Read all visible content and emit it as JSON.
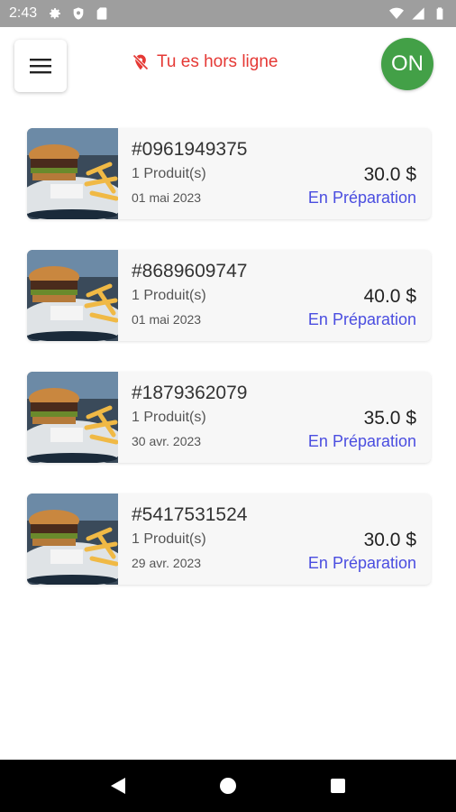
{
  "status_bar": {
    "time": "2:43",
    "icons_left": [
      "gear-icon",
      "shield-icon",
      "sd-card-icon"
    ],
    "icons_right": [
      "wifi-icon",
      "signal-icon",
      "battery-icon"
    ]
  },
  "header": {
    "menu_icon": "hamburger-menu-icon",
    "offline_icon": "location-off-icon",
    "offline_text": "Tu es hors ligne",
    "on_label": "ON",
    "colors": {
      "offline": "#e53935",
      "on_button": "#43a047"
    }
  },
  "orders": [
    {
      "id": "#0961949375",
      "quantity": "1 Produit(s)",
      "date": "01 mai 2023",
      "price": "30.0 $",
      "status": "En Préparation"
    },
    {
      "id": "#8689609747",
      "quantity": "1 Produit(s)",
      "date": "01 mai 2023",
      "price": "40.0 $",
      "status": "En Préparation"
    },
    {
      "id": "#1879362079",
      "quantity": "1 Produit(s)",
      "date": "30 avr. 2023",
      "price": "35.0 $",
      "status": "En Préparation"
    },
    {
      "id": "#5417531524",
      "quantity": "1 Produit(s)",
      "date": "29 avr. 2023",
      "price": "30.0 $",
      "status": "En Préparation"
    }
  ],
  "status_color": "#4a4de0",
  "nav_bar": {
    "icons": [
      "back-icon",
      "home-icon",
      "recents-icon"
    ]
  }
}
